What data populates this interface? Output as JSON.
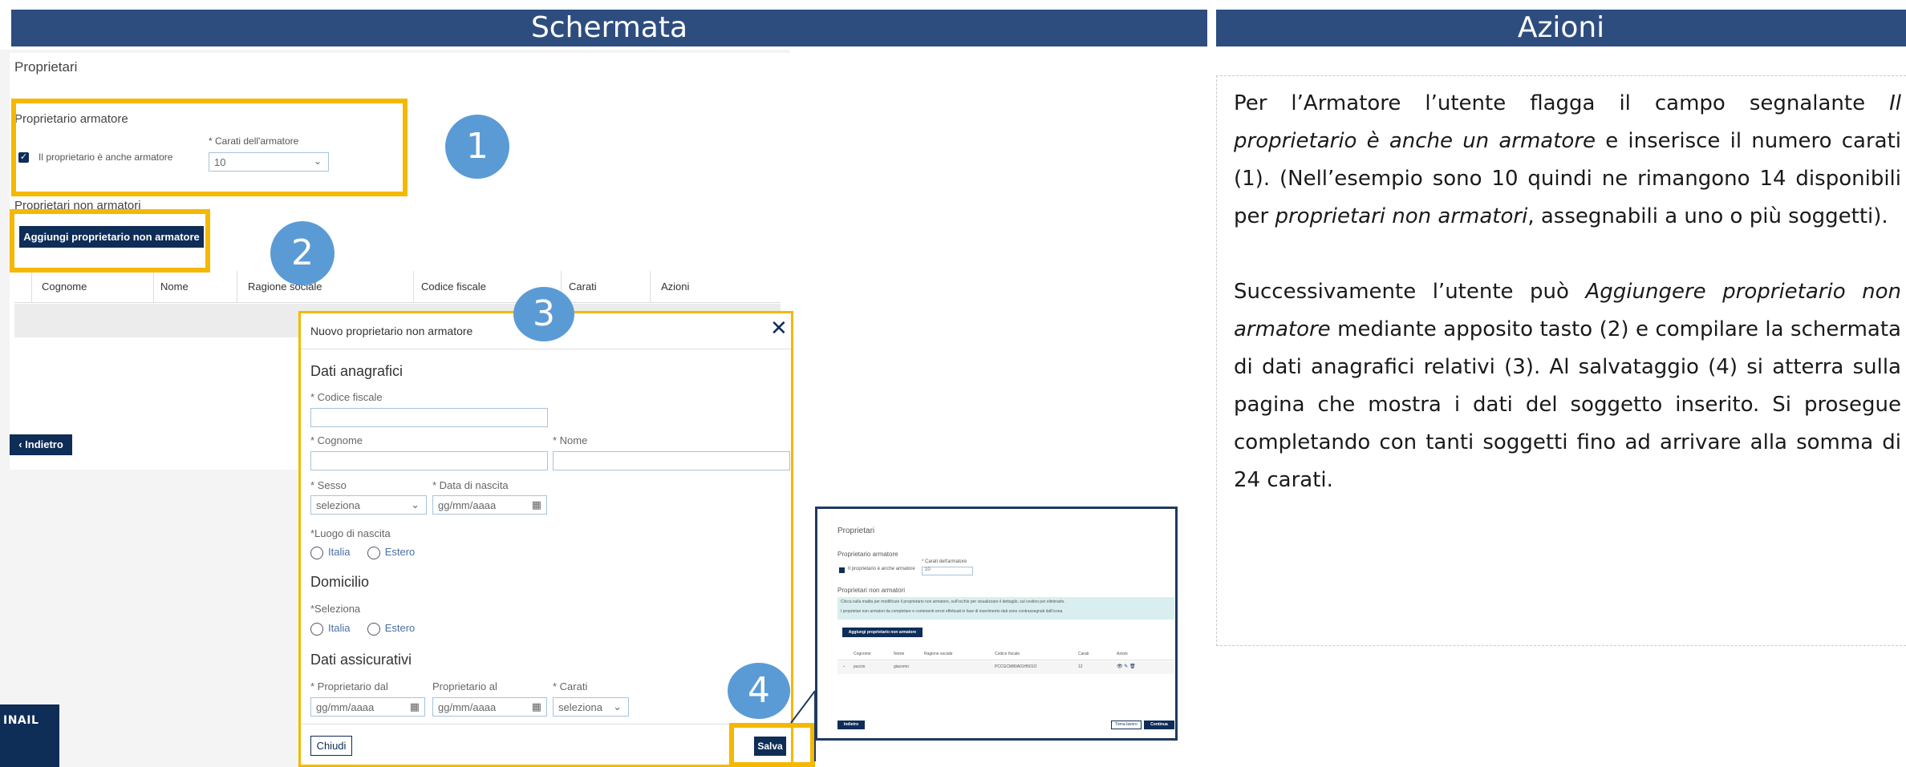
{
  "headers": {
    "left": "Schermata",
    "right": "Azioni"
  },
  "page": {
    "title": "Proprietari",
    "armatore_section": "Proprietario armatore",
    "armatore_checkbox_label": "Il proprietario è anche armatore",
    "carati_label": "* Carati dell'armatore",
    "carati_value": "10",
    "non_armatori_section": "Proprietari non armatori",
    "add_button": "Aggiungi proprietario non armatore",
    "table_headers": [
      "Cognome",
      "Nome",
      "Ragione sociale",
      "Codice fiscale",
      "Carati",
      "Azioni"
    ],
    "back_button": "Indietro",
    "logo": "INAIL"
  },
  "markers": [
    "1",
    "2",
    "3",
    "4"
  ],
  "modal": {
    "title": "Nuovo proprietario non armatore",
    "dati_anagrafici": "Dati anagrafici",
    "codice_fiscale": "* Codice fiscale",
    "cognome": "* Cognome",
    "nome": "* Nome",
    "sesso": "* Sesso",
    "sesso_value": "seleziona",
    "data_nascita": "* Data di nascita",
    "date_placeholder": "gg/mm/aaaa",
    "luogo_nascita": "*Luogo di nascita",
    "italia": "Italia",
    "estero": "Estero",
    "domicilio": "Domicilio",
    "seleziona_label": "*Seleziona",
    "dati_assicurativi": "Dati assicurativi",
    "proprietario_dal": "* Proprietario dal",
    "proprietario_al": "Proprietario al",
    "carati": "* Carati",
    "carati_value": "seleziona",
    "chiudi": "Chiudi",
    "salva": "Salva"
  },
  "thumbnail": {
    "title": "Proprietari",
    "armatore_section": "Proprietario armatore",
    "checkbox_label": "Il proprietario è anche armatore",
    "carati_label": "* Carati dell'armatore",
    "carati_value": "10",
    "non_armatori_section": "Proprietari non armatori",
    "info_line1": "Clicca sulla matita per modificare il proprietario non armatore, sull'occhio per visualizzare il dettaglio, sul cestino per eliminarlo.",
    "info_line2": "I proprietari non armatori da completare e contenenti errori effettuati in fase di inserimento dati sono contrassegnati dall'icona",
    "add_button": "Aggiungi proprietario non armatore",
    "table_headers": [
      "Cognome",
      "Nome",
      "Ragione sociale",
      "Codice fiscale",
      "Carati",
      "Azioni"
    ],
    "row": {
      "cognome": "puccio",
      "nome": "giacomo",
      "ragione": "",
      "codice": "PCCGCM80A01H501O",
      "carati": "12"
    },
    "back_button": "Indietro",
    "torna_button": "Torna lavoro",
    "continua_button": "Continua"
  },
  "actions_text": {
    "p1_a": "Per l’Armatore l’utente flagga il campo segnalante ",
    "p1_em1": "Il proprietario è anche un armatore",
    "p1_b": " e inserisce il numero carati (1). (Nell’esempio sono 10 quindi ne rimangono 14 disponibili per ",
    "p1_em2": "proprietari non armatori",
    "p1_c": ", assegnabili a uno o più soggetti).",
    "p2_a": "Successivamente l’utente può ",
    "p2_em1": "Aggiungere proprietario non armatore",
    "p2_b": " mediante apposito tasto (2) e compilare la schermata di dati anagrafici relativi (3). Al salvataggio (4) si atterra sulla pagina che mostra i dati del soggetto inserito. Si prosegue completando con tanti soggetti fino ad arrivare alla somma di 24 carati."
  },
  "colors": {
    "header": "#2e4d7f",
    "highlight": "#f5b800",
    "marker": "#5b9bd5",
    "button": "#0e2d57"
  }
}
